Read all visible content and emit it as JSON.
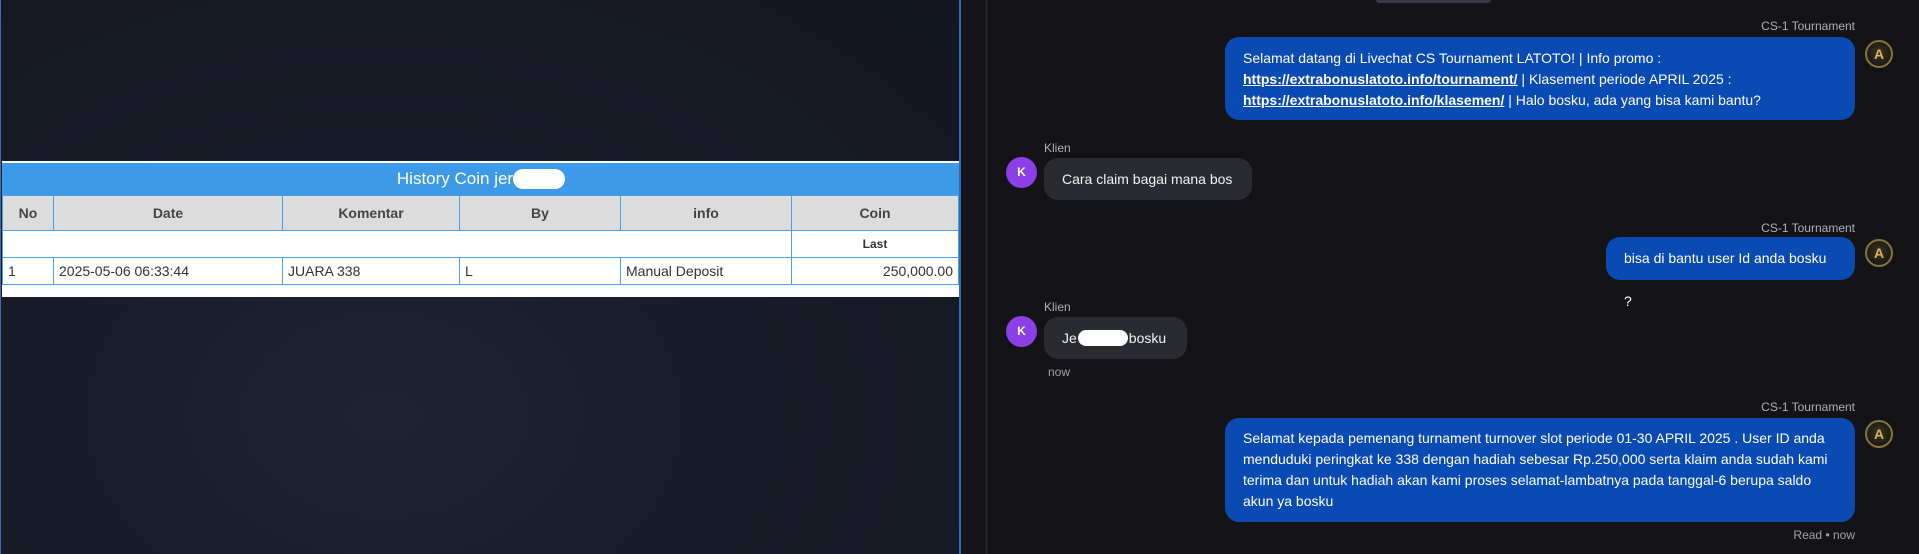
{
  "history": {
    "title": "History Coin jer",
    "columns": [
      "No",
      "Date",
      "Komentar",
      "By",
      "info",
      "Coin"
    ],
    "sub_header": "Last",
    "rows": [
      {
        "no": "1",
        "date": "2025-05-06 06:33:44",
        "komentar": "JUARA 338",
        "by": "L",
        "info": "Manual Deposit",
        "coin": "250,000.00"
      }
    ]
  },
  "chat": {
    "messages": [
      {
        "sender": "CS-1 Tournament",
        "line1": "Selamat datang di Livechat CS Tournament LATOTO! | Info promo :",
        "link1": "https://extrabonuslatoto.info/tournament/",
        "line2_rest": " | Klasement periode APRIL 2025 :",
        "link2": "https://extrabonuslatoto.info/klasemen/",
        "line3_rest": " | Halo bosku, ada yang bisa kami bantu?"
      },
      {
        "sender": "Klien",
        "avatar": "K",
        "text": "Cara claim bagai mana bos"
      },
      {
        "sender": "CS-1 Tournament",
        "text": "bisa di bantu user Id anda bosku ?"
      },
      {
        "sender": "Klien",
        "avatar": "K",
        "text_before": "Je",
        "text_after": "bosku",
        "time": "now"
      },
      {
        "sender": "CS-1 Tournament",
        "lines": [
          "Selamat kepada pemenang turnament turnover slot periode 01-30 APRIL 2025 . User ID anda",
          "menduduki peringkat ke 338 dengan hadiah sebesar Rp.250,000 serta klaim anda sudah kami",
          "terima dan untuk hadiah akan kami proses selamat-lambatnya pada tanggal-6 berupa saldo",
          "akun ya bosku"
        ],
        "status": "Read • now"
      }
    ]
  },
  "colors": {
    "agent_bubble": "#0a4ab3",
    "client_bubble": "#2a2b31",
    "client_avatar": "#8b3fe6",
    "table_header": "#3d9ae8",
    "coin_green": "#1e8c22"
  },
  "icons": {
    "agent_avatar": "A-gold-emblem",
    "client_avatar": "letter-K-circle"
  }
}
